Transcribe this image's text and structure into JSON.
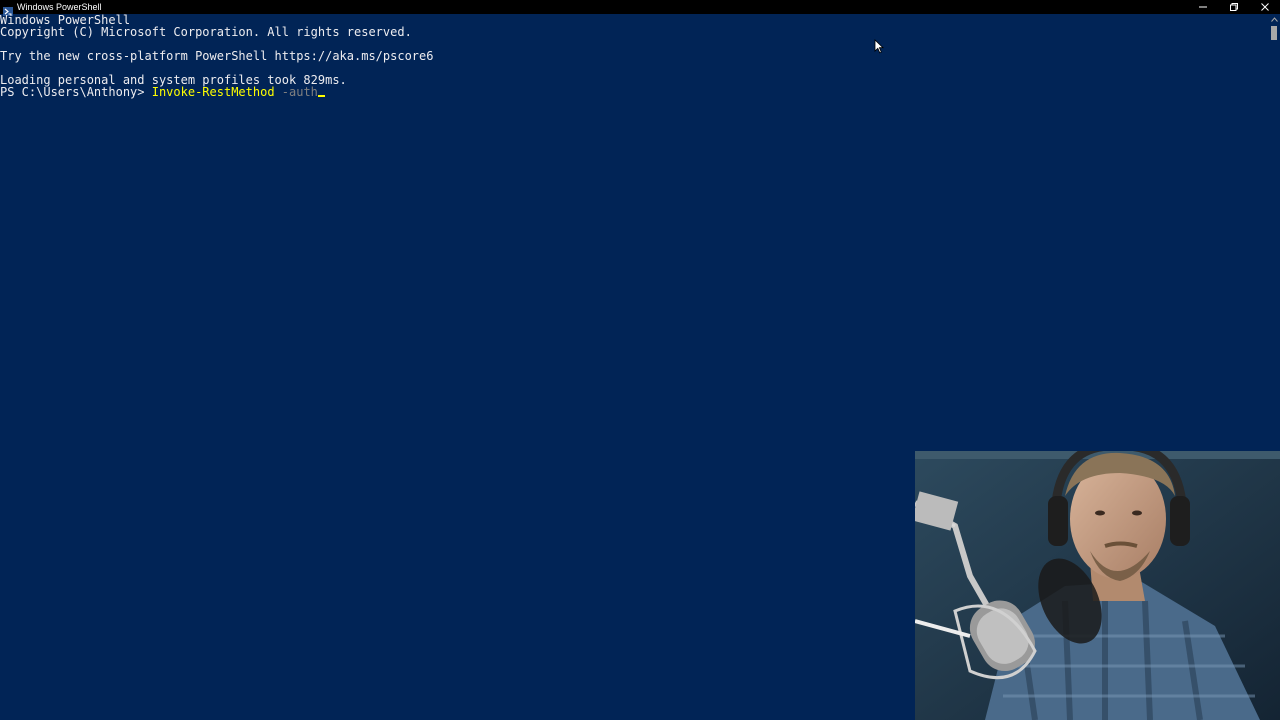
{
  "window": {
    "title": "Windows PowerShell",
    "icon": "powershell-icon",
    "controls": [
      "minimize-icon",
      "restore-icon",
      "close-icon"
    ]
  },
  "console": {
    "header_line1": "Windows PowerShell",
    "header_line2": "Copyright (C) Microsoft Corporation. All rights reserved.",
    "pscore_line": "Try the new cross-platform PowerShell https://aka.ms/pscore6",
    "profile_line": "Loading personal and system profiles took 829ms.",
    "prompt": "PS C:\\Users\\Anthony> ",
    "command": "Invoke-RestMethod",
    "param": " -auth"
  },
  "colors": {
    "background": "#012456",
    "text": "#EEEDF0",
    "cmdlet": "#FFFF00",
    "param": "#808080"
  }
}
